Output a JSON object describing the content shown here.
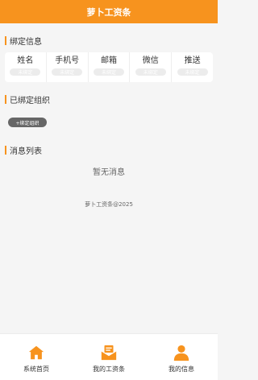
{
  "header": {
    "title": "萝卜工资条"
  },
  "binding_info": {
    "section_title": "绑定信息",
    "columns": [
      {
        "label": "姓名",
        "status": "未绑定"
      },
      {
        "label": "手机号",
        "status": "未绑定"
      },
      {
        "label": "邮箱",
        "status": "未绑定"
      },
      {
        "label": "微信",
        "status": "未绑定"
      },
      {
        "label": "推送",
        "status": "未绑定"
      }
    ]
  },
  "orgs": {
    "section_title": "已绑定组织",
    "bind_button_label": "+绑定组织"
  },
  "messages": {
    "section_title": "消息列表",
    "empty_text": "暂无消息"
  },
  "footer_text": "萝卜工资条@2025",
  "tabs": [
    {
      "label": "系统首页",
      "icon": "home-icon"
    },
    {
      "label": "我的工资条",
      "icon": "payslip-icon"
    },
    {
      "label": "我的信息",
      "icon": "user-icon"
    }
  ],
  "colors": {
    "accent": "#f7931e"
  }
}
